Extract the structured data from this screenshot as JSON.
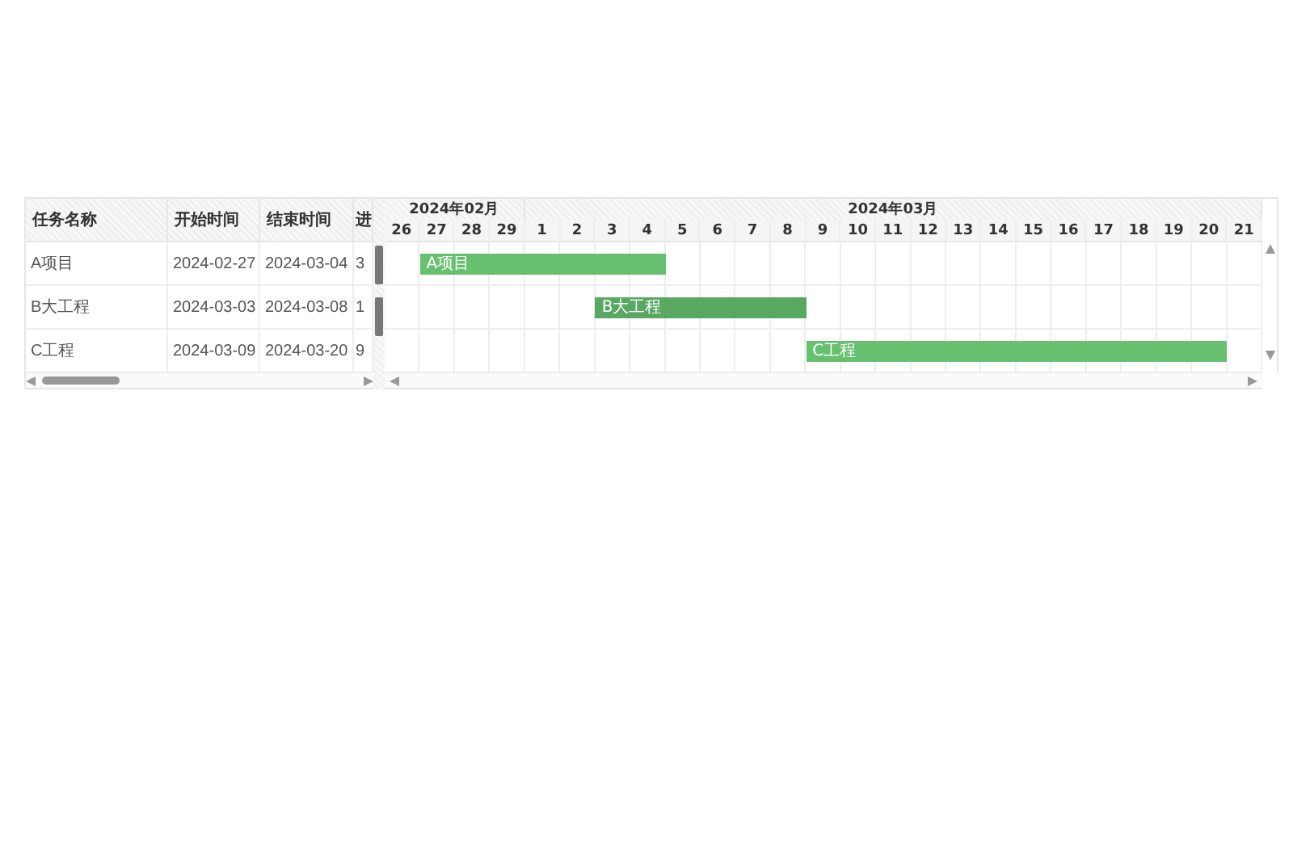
{
  "grid": {
    "columns": [
      "任务名称",
      "开始时间",
      "结束时间",
      "进"
    ],
    "rows": [
      {
        "name": "A项目",
        "start": "2024-02-27",
        "end": "2024-03-04",
        "progress": "3"
      },
      {
        "name": "B大工程",
        "start": "2024-03-03",
        "end": "2024-03-08",
        "progress": "1"
      },
      {
        "name": "C工程",
        "start": "2024-03-09",
        "end": "2024-03-20",
        "progress": "9"
      }
    ]
  },
  "timeline": {
    "months": [
      {
        "label": "2024年02月",
        "days": [
          "26",
          "27",
          "28",
          "29"
        ]
      },
      {
        "label": "2024年03月",
        "days": [
          "1",
          "2",
          "3",
          "4",
          "5",
          "6",
          "7",
          "8",
          "9",
          "10",
          "11",
          "12",
          "13",
          "14",
          "15",
          "16",
          "17",
          "18",
          "19",
          "20",
          "21"
        ]
      }
    ]
  },
  "bars": [
    {
      "label": "A项目",
      "color": "#66c070"
    },
    {
      "label": "B大工程",
      "color": "#58a862"
    },
    {
      "label": "C工程",
      "color": "#66c070"
    }
  ]
}
